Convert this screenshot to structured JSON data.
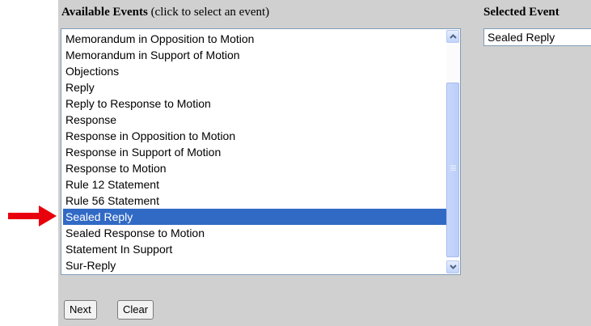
{
  "available_header": {
    "bold": "Available Events",
    "hint": "(click to select an event)"
  },
  "selected_header": "Selected Event",
  "events": [
    "Memorandum in Opposition to Motion",
    "Memorandum in Support of Motion",
    "Objections",
    "Reply",
    "Reply to Response to Motion",
    "Response",
    "Response in Opposition to Motion",
    "Response in Support of Motion",
    "Response to Motion",
    "Rule 12 Statement",
    "Rule 56 Statement",
    "Sealed Reply",
    "Sealed Response to Motion",
    "Statement In Support",
    "Sur-Reply"
  ],
  "selected_index": 11,
  "selected_events": [
    "Sealed Reply"
  ],
  "buttons": {
    "next": "Next",
    "clear": "Clear"
  },
  "colors": {
    "selection": "#316ac5",
    "arrow": "#e8000c",
    "panel": "#d0d0d0"
  },
  "icons": {
    "scroll_up": "chevron-up-icon",
    "scroll_down": "chevron-down-icon",
    "pointer": "red-arrow-icon"
  }
}
